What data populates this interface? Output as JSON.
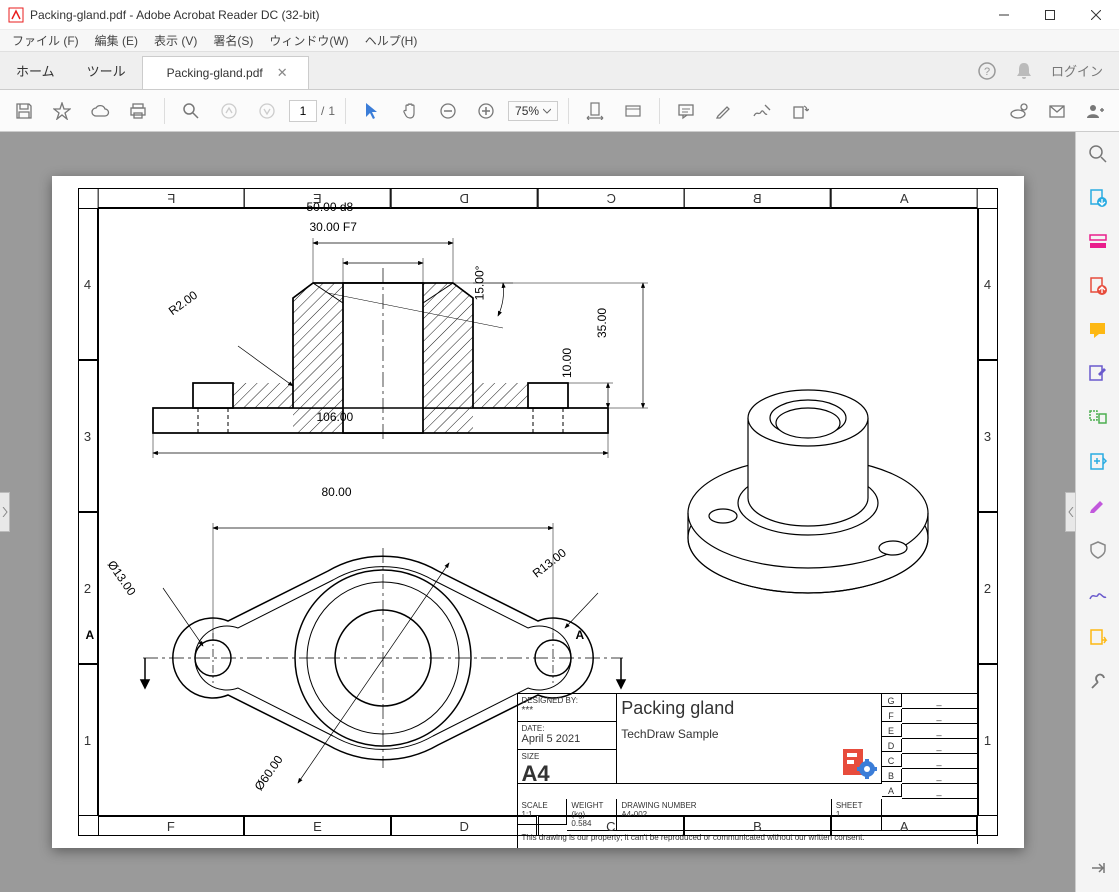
{
  "window": {
    "title": "Packing-gland.pdf - Adobe Acrobat Reader DC (32-bit)"
  },
  "menu": {
    "file": "ファイル (F)",
    "edit": "編集 (E)",
    "view": "表示 (V)",
    "sign": "署名(S)",
    "window": "ウィンドウ(W)",
    "help": "ヘルプ(H)"
  },
  "tabs": {
    "home": "ホーム",
    "tools": "ツール",
    "doc": "Packing-gland.pdf",
    "login": "ログイン"
  },
  "toolbar": {
    "page_current": "1",
    "page_sep": "/",
    "page_total": "1",
    "zoom": "75%"
  },
  "drawing": {
    "zones_h": [
      "F",
      "E",
      "D",
      "C",
      "B",
      "A"
    ],
    "zones_v": [
      "4",
      "3",
      "2",
      "1"
    ],
    "dims": {
      "d50": "50.00  d8",
      "d30": "30.00  F7",
      "d106": "106.00",
      "d80": "80.00",
      "d35": "35.00",
      "d10": "10.00",
      "d15": "15.00°",
      "r2": "R2.00",
      "r13": "R13.00",
      "phi13": "Ø13.00",
      "phi60": "Ø60.00",
      "secA1": "A",
      "secA2": "A"
    },
    "titleblock": {
      "designed_lbl": "DESIGNED BY:",
      "designed": "***",
      "date_lbl": "DATE:",
      "date": "April 5 2021",
      "size_lbl": "SIZE",
      "size": "A4",
      "title": "Packing gland",
      "subtitle": "TechDraw Sample",
      "scale_lbl": "SCALE",
      "scale": "1:1",
      "weight_lbl": "WEIGHT (kg)",
      "weight": "0.584",
      "dwgnum_lbl": "DRAWING NUMBER",
      "dwgnum": "A4-002",
      "sheet_lbl": "SHEET",
      "sheet": "1",
      "note": "This drawing is our property; it can't be reproduced or communicated without our written consent.",
      "rev_letters": [
        "G",
        "F",
        "E",
        "D",
        "C",
        "B",
        "A"
      ],
      "rev_dash": "_"
    }
  }
}
